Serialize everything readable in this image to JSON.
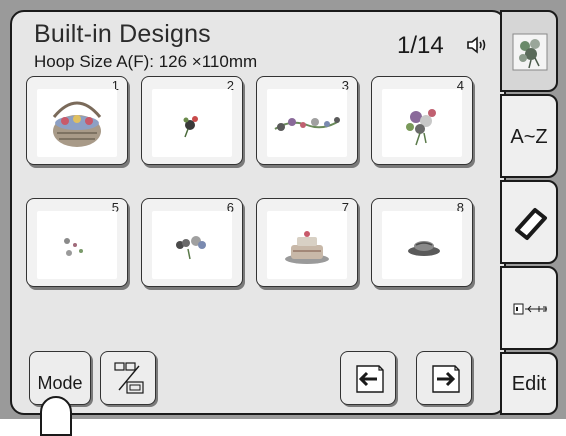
{
  "header": {
    "title": "Built-in Designs",
    "hoop_size": "Hoop Size  A(F): 126 ×110mm",
    "page_indicator": "1/14"
  },
  "designs": [
    {
      "number": "1",
      "icon": "flower-basket-icon"
    },
    {
      "number": "2",
      "icon": "small-flower-icon"
    },
    {
      "number": "3",
      "icon": "flower-border-icon"
    },
    {
      "number": "4",
      "icon": "flower-cluster-icon"
    },
    {
      "number": "5",
      "icon": "scattered-flower-icon"
    },
    {
      "number": "6",
      "icon": "flower-sprig-icon"
    },
    {
      "number": "7",
      "icon": "cake-icon"
    },
    {
      "number": "8",
      "icon": "hat-icon"
    }
  ],
  "toolbar": {
    "mode_label": "Mode"
  },
  "side_tabs": {
    "alphabet_label": "A~Z",
    "edit_label": "Edit"
  },
  "colors": {
    "screen_bg": "#e6e6e6",
    "tile_bg": "#f2f2f2",
    "frame": "#9a9a9a",
    "border": "#1a1a1a"
  }
}
